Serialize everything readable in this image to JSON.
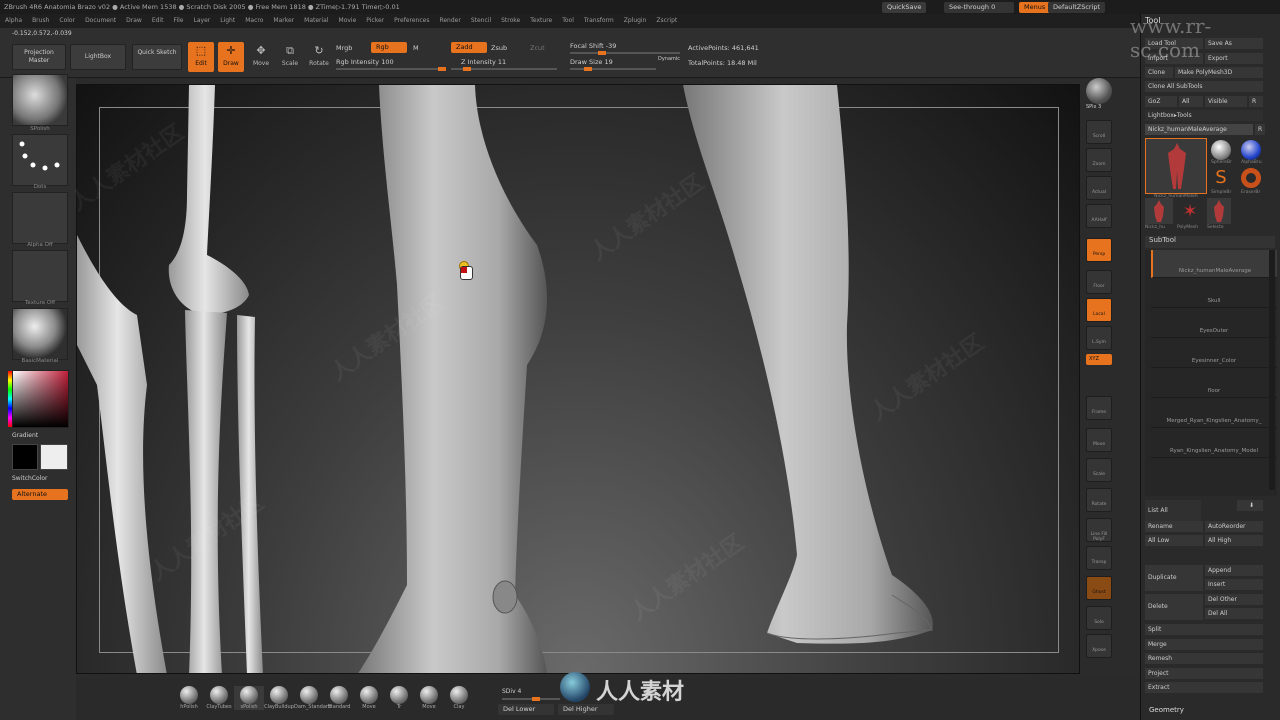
{
  "title_bar": {
    "text": "ZBrush 4R6    Anatomia Brazo v02    ● Active Mem 1538 ● Scratch Disk 2005 ● Free Mem 1818 ● ZTime▷1.791 Timer▷0.01"
  },
  "top_right": {
    "quicksave": "QuickSave",
    "see_through": "See-through  0",
    "menus": "Menus",
    "default_zscript": "DefaultZScript"
  },
  "menu_items": [
    "Alpha",
    "Brush",
    "Color",
    "Document",
    "Draw",
    "Edit",
    "File",
    "Layer",
    "Light",
    "Macro",
    "Marker",
    "Material",
    "Movie",
    "Picker",
    "Preferences",
    "Render",
    "Stencil",
    "Stroke",
    "Texture",
    "Tool",
    "Transform",
    "Zplugin",
    "Zscript"
  ],
  "coords": "-0.152,0.572,-0.039",
  "toolbar": {
    "projection_master": "Projection Master",
    "lightbox": "LightBox",
    "quick_sketch": "Quick Sketch",
    "edit": "Edit",
    "draw": "Draw",
    "move": "Move",
    "scale": "Scale",
    "rotate": "Rotate",
    "mrgb": "Mrgb",
    "rgb": "Rgb",
    "m": "M",
    "rgb_intensity": "Rgb Intensity 100",
    "zadd": "Zadd",
    "zsub": "Zsub",
    "zcut": "Zcut",
    "z_intensity": "Z Intensity 11",
    "focal_shift": "Focal Shift -39",
    "draw_size": "Draw Size 19",
    "dynamic": "Dynamic",
    "active_points": "ActivePoints: 461,641",
    "total_points": "TotalPoints: 18.48 Mil"
  },
  "left_shelf": {
    "brush": "SPolish",
    "stroke": "Dots",
    "alpha": "Alpha Off",
    "texture": "Texture Off",
    "material": "BasicMaterial",
    "gradient": "Gradient",
    "switch_color": "SwitchColor",
    "alternate": "Alternate"
  },
  "right_shelf": [
    "SPix 3",
    "Scroll",
    "Zoom",
    "Actual",
    "AAHalf",
    "Persp",
    "Floor",
    "Local",
    "L.Sym",
    "XYZ",
    "Frame",
    "Move",
    "Scale",
    "Rotate",
    "Line Fill PolyF",
    "Transp",
    "Ghost",
    "Solo",
    "Xpose"
  ],
  "tool_panel": {
    "header": "Tool",
    "load_tool": "Load Tool",
    "save_as": "Save As",
    "import": "Import",
    "export": "Export",
    "clone": "Clone",
    "make_polymesh": "Make PolyMesh3D",
    "clone_all": "Clone All SubTools",
    "goz": "GoZ",
    "all": "All",
    "visible": "Visible",
    "r": "R",
    "lightbox_tools": "Lightbox▸Tools",
    "current_tool": "Nickz_humanMaleAverage",
    "tool_thumbs": [
      "Nickz_humanMaleA",
      "SphereBr",
      "AlphaBru",
      "SimpleBr",
      "EraserBr",
      "Nickz_hu",
      "PolyMesh",
      "Selecte"
    ],
    "subtool_header": "SubTool",
    "subtools": [
      "Nickz_humanMaleAverage",
      "Skull",
      "EyesOuter",
      "Eyesinner_Color",
      "floor",
      "Merged_Ryan_Kingslien_Anatomy_",
      "Ryan_Kingslien_Anatomy_Model"
    ],
    "list_all": "List All",
    "rename": "Rename",
    "autoreorder": "AutoReorder",
    "all_low": "All Low",
    "all_high": "All High",
    "duplicate": "Duplicate",
    "append": "Append",
    "insert": "Insert",
    "delete": "Delete",
    "del_other": "Del Other",
    "del_all": "Del All",
    "split": "Split",
    "merge": "Merge",
    "remesh": "Remesh",
    "project": "Project",
    "extract": "Extract",
    "geometry": "Geometry"
  },
  "bottom": {
    "brushes": [
      "hPolish",
      "ClayTubes",
      "sPolish",
      "ClayBuildup",
      "Dam_Standard",
      "Standard",
      "Move",
      "Tr",
      "Move",
      "Clay"
    ],
    "sdiv": "SDiv 4",
    "del_lower": "Del Lower",
    "del_higher": "Del Higher"
  },
  "watermark": {
    "site": "www.rr-sc.com",
    "logo_text": "人人素材",
    "pattern": "人人素材社区"
  }
}
